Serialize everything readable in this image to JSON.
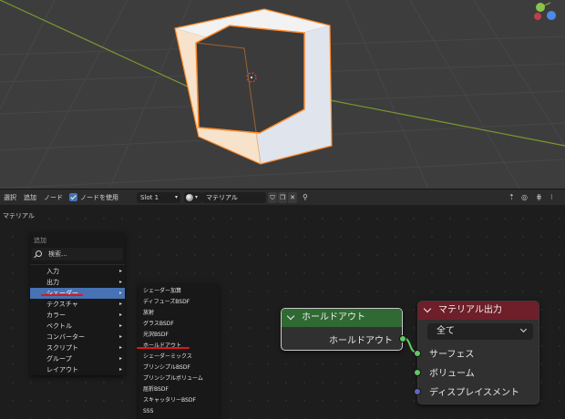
{
  "header": {
    "menu_select": "選択",
    "menu_add": "追加",
    "menu_node": "ノード",
    "use_nodes_label": "ノードを使用",
    "slot_label": "Slot 1",
    "material_name": "マテリアル"
  },
  "breadcrumb": "マテリアル",
  "add_menu": {
    "title": "追加",
    "search_placeholder": "検索...",
    "items": [
      {
        "label": "入力"
      },
      {
        "label": "出力"
      },
      {
        "label": "シェーダー"
      },
      {
        "label": "テクスチャ"
      },
      {
        "label": "カラー"
      },
      {
        "label": "ベクトル"
      },
      {
        "label": "コンバーター"
      },
      {
        "label": "スクリプト"
      },
      {
        "label": "グループ"
      },
      {
        "label": "レイアウト"
      }
    ],
    "active_index": 2
  },
  "shader_submenu": {
    "items": [
      "シェーダー加算",
      "ディフューズBSDF",
      "放射",
      "グラスBSDF",
      "光沢BSDF",
      "ホールドアウト",
      "シェーダーミックス",
      "プリンシプルBSDF",
      "プリンシプルボリューム",
      "屈折BSDF",
      "スキャッタリーBSDF",
      "SSS"
    ]
  },
  "holdout_node": {
    "title": "ホールドアウト",
    "output_label": "ホールドアウト",
    "header_color": "#2f6a32"
  },
  "material_output_node": {
    "title": "マテリアル出力",
    "target": "全て",
    "header_color": "#6e1f29",
    "inputs": [
      {
        "label": "サーフェス",
        "color": "#63c763"
      },
      {
        "label": "ボリューム",
        "color": "#63c763"
      },
      {
        "label": "ディスプレイスメント",
        "color": "#6363c7"
      }
    ]
  },
  "colors": {
    "accent": "#4772b3",
    "selection_outline": "#ff8a2a",
    "annotation_red": "#e0161b"
  }
}
